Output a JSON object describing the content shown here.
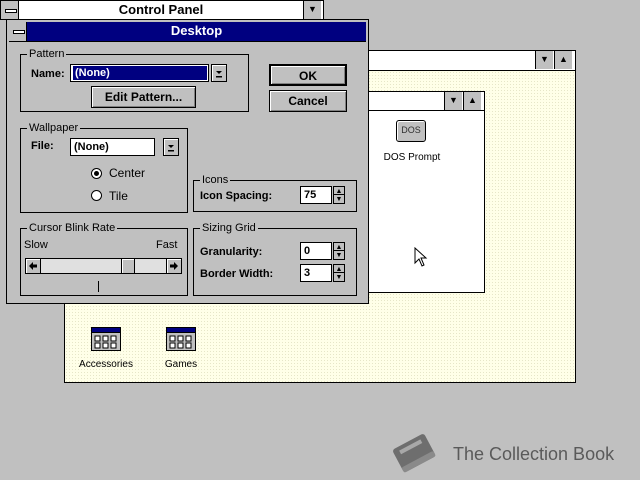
{
  "control_panel": {
    "title": "Control Panel"
  },
  "desktop_dialog": {
    "title": "Desktop",
    "ok_label": "OK",
    "cancel_label": "Cancel",
    "pattern": {
      "group_label": "Pattern",
      "name_label": "Name:",
      "name_value": "(None)",
      "edit_label": "Edit Pattern..."
    },
    "wallpaper": {
      "group_label": "Wallpaper",
      "file_label": "File:",
      "file_value": "(None)",
      "center_label": "Center",
      "tile_label": "Tile",
      "selected": "Center"
    },
    "icons": {
      "group_label": "Icons",
      "spacing_label": "Icon Spacing:",
      "spacing_value": "75"
    },
    "cursor_blink": {
      "group_label": "Cursor Blink Rate",
      "slow_label": "Slow",
      "fast_label": "Fast",
      "rate_fraction": 0.72
    },
    "sizing_grid": {
      "group_label": "Sizing Grid",
      "granularity_label": "Granularity:",
      "granularity_value": "0",
      "border_width_label": "Border Width:",
      "border_width_value": "3"
    }
  },
  "program_manager": {
    "groups": [
      {
        "label": "Accessories"
      },
      {
        "label": "Games"
      }
    ],
    "main_group": {
      "dos_icon_text": "DOS",
      "dos_label": "DOS Prompt"
    }
  },
  "watermark": {
    "text": "The Collection Book"
  }
}
